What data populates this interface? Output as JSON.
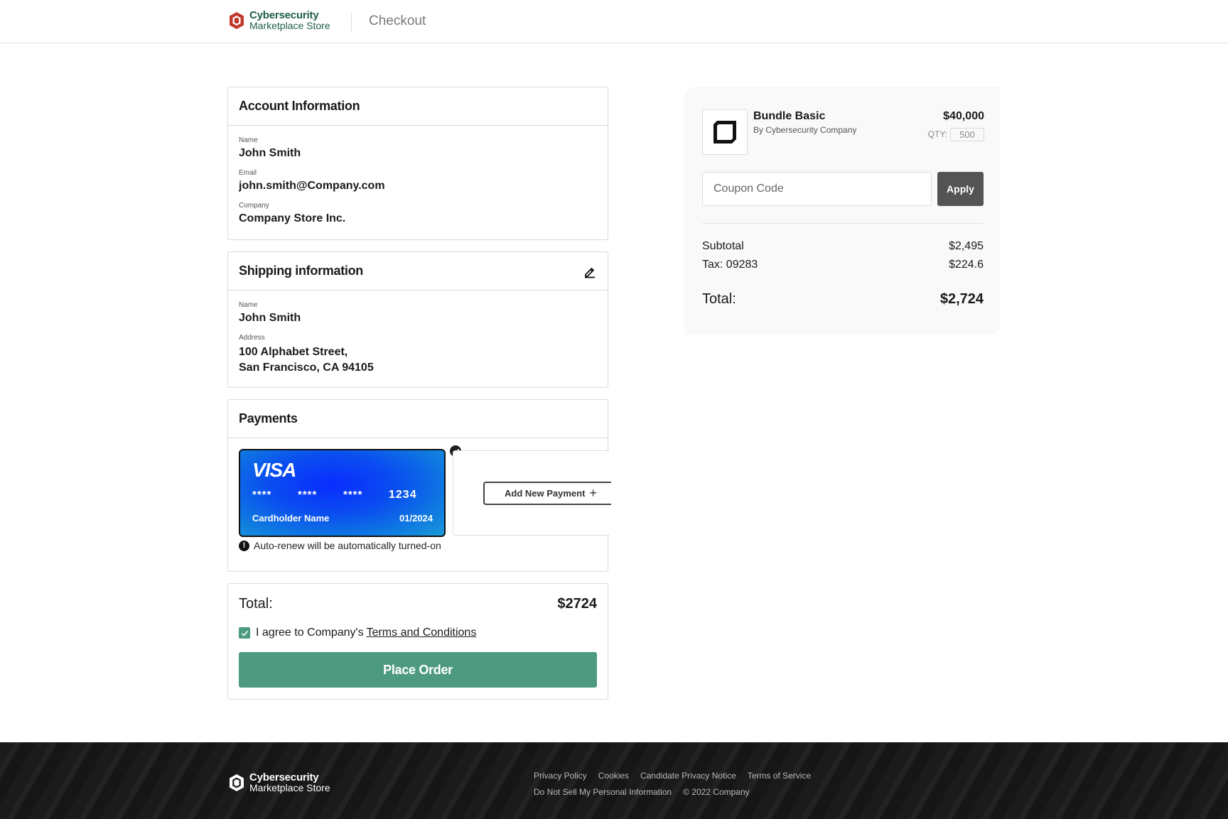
{
  "header": {
    "brand_line1": "Cybersecurity",
    "brand_line2": "Marketplace Store",
    "page_title": "Checkout"
  },
  "account": {
    "title": "Account Information",
    "fields": [
      {
        "label": "Name",
        "value": "John Smith"
      },
      {
        "label": "Email",
        "value": "john.smith@Company.com"
      },
      {
        "label": "Company",
        "value": "Company Store Inc."
      }
    ]
  },
  "shipping": {
    "title": "Shipping information",
    "name_label": "Name",
    "name_value": "John Smith",
    "address_label": "Address",
    "address_line1": "100 Alphabet Street,",
    "address_line2": "San Francisco, CA 94105"
  },
  "payments": {
    "title": "Payments",
    "card": {
      "brand": "VISA",
      "groups": [
        "****",
        "****",
        "****"
      ],
      "last4": "1234",
      "holder": "Cardholder Name",
      "expiry": "01/2024"
    },
    "add_new_label": "Add New Payment",
    "autorenew_notice": "Auto-renew will be automatically turned-on"
  },
  "order": {
    "total_label": "Total:",
    "total_value": "$2724",
    "agree_text": "I agree to Company's",
    "terms_link": "Terms and Conditions",
    "agree_checked": true,
    "place_order_label": "Place Order"
  },
  "summary": {
    "product_name": "Bundle Basic",
    "product_by": "By Cybersecurity Company",
    "product_price": "$40,000",
    "qty_label": "QTY:",
    "qty_value": "500",
    "coupon_placeholder": "Coupon Code",
    "apply_label": "Apply",
    "subtotal_label": "Subtotal",
    "subtotal_value": "$2,495",
    "tax_label": "Tax: 09283",
    "tax_value": "$224.6",
    "total_label": "Total:",
    "total_value": "$2,724"
  },
  "footer": {
    "brand_line1": "Cybersecurity",
    "brand_line2": "Marketplace Store",
    "links_row1": [
      "Privacy Policy",
      "Cookies",
      "Candidate Privacy Notice",
      "Terms of Service"
    ],
    "links_row2": [
      "Do Not Sell My Personal Information"
    ],
    "copyright": "© 2022 Company"
  },
  "colors": {
    "brand_green": "#1d5e4c",
    "primary_button": "#4e9a81",
    "apply_button": "#545454",
    "brand_icon_red": "#c0392b"
  },
  "icons": {
    "brand": "hexagon-logo-icon",
    "edit": "pencil-edit-icon",
    "selected": "check-circle-icon",
    "info": "exclamation-circle-icon",
    "add": "plus-icon",
    "product": "product-box-icon"
  }
}
